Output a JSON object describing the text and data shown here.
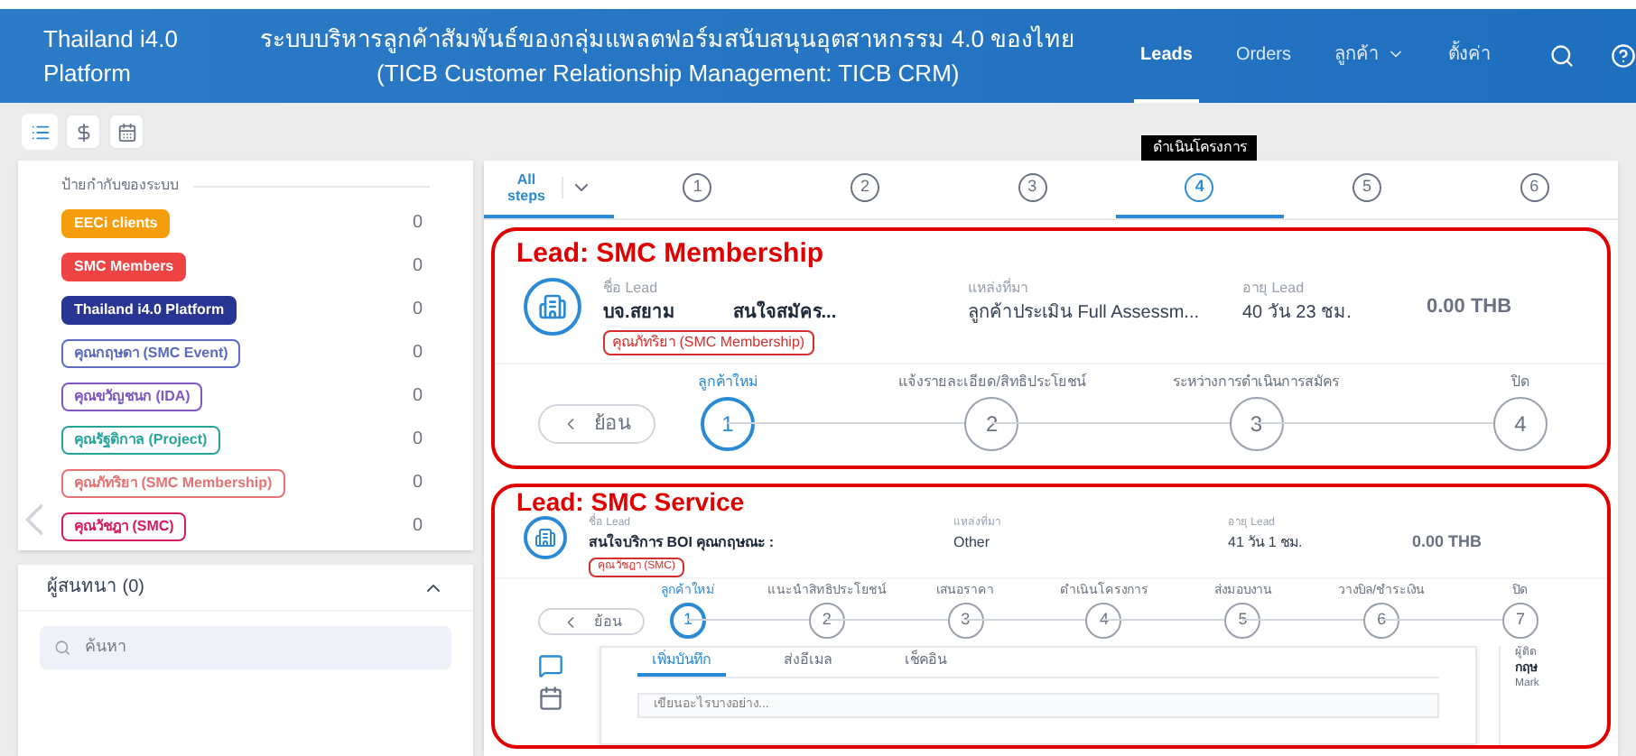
{
  "header": {
    "brand": "Thailand i4.0 Platform",
    "title": "ระบบบริหารลูกค้าสัมพันธ์ของกลุ่มแพลตฟอร์มสนับสนุนอุตสาหกรรม 4.0 ของไทย",
    "subtitle": "(TICB Customer Relationship Management: TICB CRM)",
    "nav": [
      {
        "label": "Leads",
        "selected": true,
        "kind": "link"
      },
      {
        "label": "Orders",
        "selected": false,
        "kind": "link"
      },
      {
        "label": "ลูกค้า",
        "selected": false,
        "kind": "dropdown"
      },
      {
        "label": "ตั้งค่า",
        "selected": false,
        "kind": "link"
      }
    ]
  },
  "view_toggles": [
    {
      "kind": "list",
      "selected": true
    },
    {
      "kind": "money",
      "selected": false
    },
    {
      "kind": "calendar",
      "selected": false
    }
  ],
  "labels_panel": {
    "title": "ป้ายกำกับของระบบ",
    "items": [
      {
        "label": "EECi clients",
        "count": "0",
        "color": "#f59e0b",
        "kind": "filled"
      },
      {
        "label": "SMC Members",
        "count": "0",
        "color": "#ef4444",
        "kind": "filled"
      },
      {
        "label": "Thailand i4.0 Platform",
        "count": "0",
        "color": "#283593",
        "kind": "filled"
      },
      {
        "label": "คุณกฤษดา (SMC Event)",
        "count": "0",
        "color": "#5c6bc0",
        "kind": "outline"
      },
      {
        "label": "คุณขวัญชนก (IDA)",
        "count": "0",
        "color": "#7e57c2",
        "kind": "outline"
      },
      {
        "label": "คุณรัฐติกาล (Project)",
        "count": "0",
        "color": "#26a69a",
        "kind": "outline"
      },
      {
        "label": "คุณภัทริยา (SMC Membership)",
        "count": "0",
        "color": "#e57373",
        "kind": "outline"
      },
      {
        "label": "คุณวัชฎา (SMC)",
        "count": "0",
        "color": "#d81b60",
        "kind": "outline"
      }
    ]
  },
  "contacts_panel": {
    "title": "ผู้สนทนา (0)",
    "expanded": true,
    "search_placeholder": "ค้นหา"
  },
  "steps": {
    "all_label": "All steps",
    "tabs": [
      {
        "label": "1",
        "selected": false
      },
      {
        "label": "2",
        "selected": false
      },
      {
        "label": "3",
        "selected": false
      },
      {
        "label": "4",
        "selected": true,
        "tooltip": "ดำเนินโครงการ"
      },
      {
        "label": "5",
        "selected": false
      },
      {
        "label": "6",
        "selected": false
      }
    ]
  },
  "leads": [
    {
      "annotation": "Lead: SMC Membership",
      "name_label": "ชื่อ Lead",
      "name": "บจ.สยาม",
      "name_tail": "สนใจสมัคร...",
      "tag": "คุณภัทริยา (SMC Membership)",
      "source_label": "แหล่งที่มา",
      "source": "ลูกค้าประเมิน Full Assessm...",
      "age_label": "อายุ Lead",
      "age": "40 วัน 23 ชม.",
      "amount": "0.00 THB",
      "back": "ย้อน",
      "stages": [
        {
          "label": "ลูกค้าใหม่",
          "number": "1",
          "current": true
        },
        {
          "label": "แจ้งรายละเอียด/สิทธิประโยชน์",
          "number": "2",
          "current": false
        },
        {
          "label": "ระหว่างการดำเนินการสมัคร",
          "number": "3",
          "current": false
        },
        {
          "label": "ปิด",
          "number": "4",
          "current": false
        }
      ]
    },
    {
      "annotation": "Lead: SMC Service",
      "name_label": "ชื่อ Lead",
      "name": "สนใจบริการ BOI คุณกฤษณะ :",
      "tag": "คุณวัชฎา (SMC)",
      "source_label": "แหล่งที่มา",
      "source": "Other",
      "age_label": "อายุ Lead",
      "age": "41 วัน 1 ชม.",
      "amount": "0.00 THB",
      "back": "ย้อน",
      "stages": [
        {
          "label": "ลูกค้าใหม่",
          "number": "1",
          "current": true
        },
        {
          "label": "แนะนำสิทธิประโยชน์",
          "number": "2",
          "current": false
        },
        {
          "label": "เสนอราคา",
          "number": "3",
          "current": false
        },
        {
          "label": "ดำเนินโครงการ",
          "number": "4",
          "current": false
        },
        {
          "label": "ส่งมอบงาน",
          "number": "5",
          "current": false
        },
        {
          "label": "วางบิล/ชำระเงิน",
          "number": "6",
          "current": false
        },
        {
          "label": "ปิด",
          "number": "7",
          "current": false
        }
      ],
      "activity_tabs": [
        {
          "label": "เพิ่มบันทึก",
          "selected": true
        },
        {
          "label": "ส่งอีเมล",
          "selected": false
        },
        {
          "label": "เช็คอิน",
          "selected": false
        }
      ],
      "note_placeholder": "เขียนอะไรบางอย่าง...",
      "contact": {
        "heading": "ผู้ติด",
        "name": "กฤษ",
        "role": "Mark"
      }
    }
  ]
}
